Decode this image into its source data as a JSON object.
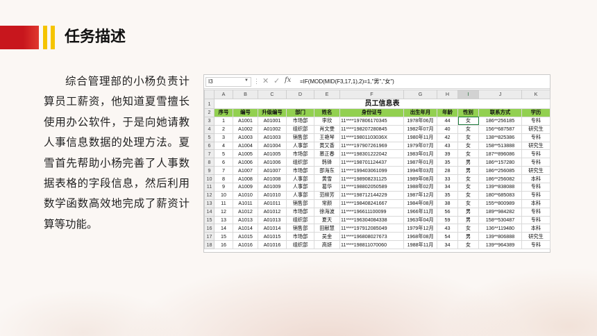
{
  "header": {
    "title": "任务描述",
    "colors": {
      "red": "#c8161d",
      "yellow": "#f5c400"
    }
  },
  "description": "综合管理部的小杨负责计算员工薪资，他知道夏雪擅长使用办公软件，于是向她请教人事信息数据的处理方法。夏雪首先帮助小杨完善了人事数据表格的字段信息，然后利用数学函数高效地完成了薪资计算等功能。",
  "spreadsheet": {
    "name_box": "I3",
    "formula": "=IF(MOD(MID(F3,17,1),2)=1,\"男\",\"女\")",
    "column_letters": [
      "A",
      "B",
      "C",
      "D",
      "E",
      "F",
      "G",
      "H",
      "I",
      "J",
      "K"
    ],
    "selected_column": "I",
    "sheet_title": "员工信息表",
    "headers": [
      "序号",
      "编号",
      "升级编号",
      "部门",
      "姓名",
      "身份证号",
      "出生年月",
      "年龄",
      "性别",
      "联系方式",
      "学历"
    ],
    "rows": [
      [
        "1",
        "A1001",
        "A01001",
        "市场部",
        "李欣",
        "11****197806170345",
        "1978年06月",
        "44",
        "女",
        "186**256185",
        "专科"
      ],
      [
        "2",
        "A1002",
        "A01002",
        "组织部",
        "肖文雯",
        "11****198207280845",
        "1982年07月",
        "40",
        "女",
        "156**687587",
        "研究生"
      ],
      [
        "3",
        "A1003",
        "A01003",
        "销售部",
        "王艳琴",
        "11****19801103036X",
        "1980年11月",
        "42",
        "女",
        "138**825386",
        "专科"
      ],
      [
        "4",
        "A1004",
        "A01004",
        "人事部",
        "黄又香",
        "11****197907261969",
        "1979年07月",
        "43",
        "女",
        "158**513888",
        "研究生"
      ],
      [
        "5",
        "A1005",
        "A01005",
        "市场部",
        "慕正春",
        "11****198301222042",
        "1983年01月",
        "39",
        "女",
        "187**896086",
        "专科"
      ],
      [
        "6",
        "A1006",
        "A01006",
        "组织部",
        "韩锋",
        "11****198701124437",
        "1987年01月",
        "35",
        "男",
        "186**157280",
        "专科"
      ],
      [
        "7",
        "A1007",
        "A01007",
        "市场部",
        "邵海东",
        "11****199403061099",
        "1994年03月",
        "28",
        "男",
        "186**256085",
        "研究生"
      ],
      [
        "8",
        "A1008",
        "A01008",
        "人事部",
        "黄雪",
        "11****198908231125",
        "1989年08月",
        "33",
        "女",
        "186**256082",
        "本科"
      ],
      [
        "9",
        "A1009",
        "A01009",
        "人事部",
        "葛华",
        "11****198802050589",
        "1988年02月",
        "34",
        "女",
        "139**838088",
        "专科"
      ],
      [
        "10",
        "A1010",
        "A01010",
        "人事部",
        "范柳芳",
        "11****198712144229",
        "1987年12月",
        "35",
        "女",
        "180**685083",
        "专科"
      ],
      [
        "11",
        "A1011",
        "A01011",
        "销售部",
        "常颜",
        "11****198408241667",
        "1984年08月",
        "38",
        "女",
        "155**800989",
        "本科"
      ],
      [
        "12",
        "A1012",
        "A01012",
        "市场部",
        "徐海波",
        "11****196611100099",
        "1966年11月",
        "56",
        "男",
        "189**984282",
        "专科"
      ],
      [
        "13",
        "A1013",
        "A01013",
        "组织部",
        "夏天",
        "11****196304084338",
        "1963年04月",
        "59",
        "男",
        "158**530487",
        "专科"
      ],
      [
        "14",
        "A1014",
        "A01014",
        "销售部",
        "田献慧",
        "11****197912085049",
        "1979年12月",
        "43",
        "女",
        "136**119480",
        "本科"
      ],
      [
        "15",
        "A1015",
        "A01015",
        "市场部",
        "吴金",
        "11****196808027673",
        "1968年08月",
        "54",
        "男",
        "139**806888",
        "研究生"
      ],
      [
        "16",
        "A1016",
        "A01016",
        "组织部",
        "高妍",
        "11****198811070060",
        "1988年11月",
        "34",
        "女",
        "139**964389",
        "专科"
      ]
    ]
  }
}
